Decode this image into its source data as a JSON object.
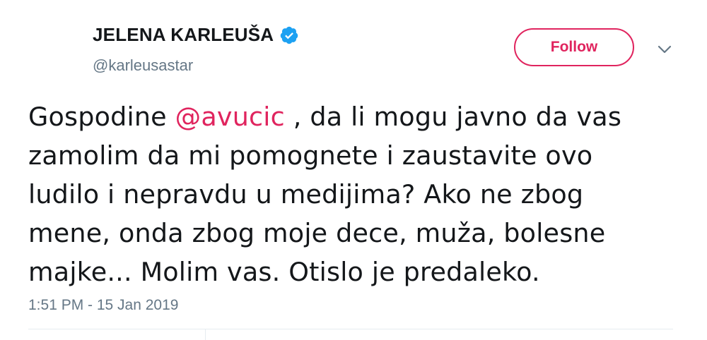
{
  "author": {
    "display_name": "JELENA KARLEUŠA",
    "handle": "@karleusastar",
    "verified_icon": "verified-badge-icon"
  },
  "actions": {
    "follow_label": "Follow",
    "more_icon": "chevron-down-icon"
  },
  "tweet": {
    "lines": [
      {
        "before": "Gospodine ",
        "mention": "@avucic",
        "after": " , da li mogu javno da vas"
      },
      {
        "text": "zamolim da mi pomognete i zaustavite ovo"
      },
      {
        "text": "ludilo i nepravdu u medijima? Ako ne zbog"
      },
      {
        "text": "mene, onda zbog moje dece, muža, bolesne"
      },
      {
        "text": "majke... Molim vas. Otislo je predaleko."
      }
    ],
    "timestamp": "1:51 PM - 15 Jan 2019"
  },
  "colors": {
    "accent": "#e0245e",
    "verified": "#1da1f2",
    "secondary_text": "#657786",
    "primary_text": "#14171a"
  }
}
